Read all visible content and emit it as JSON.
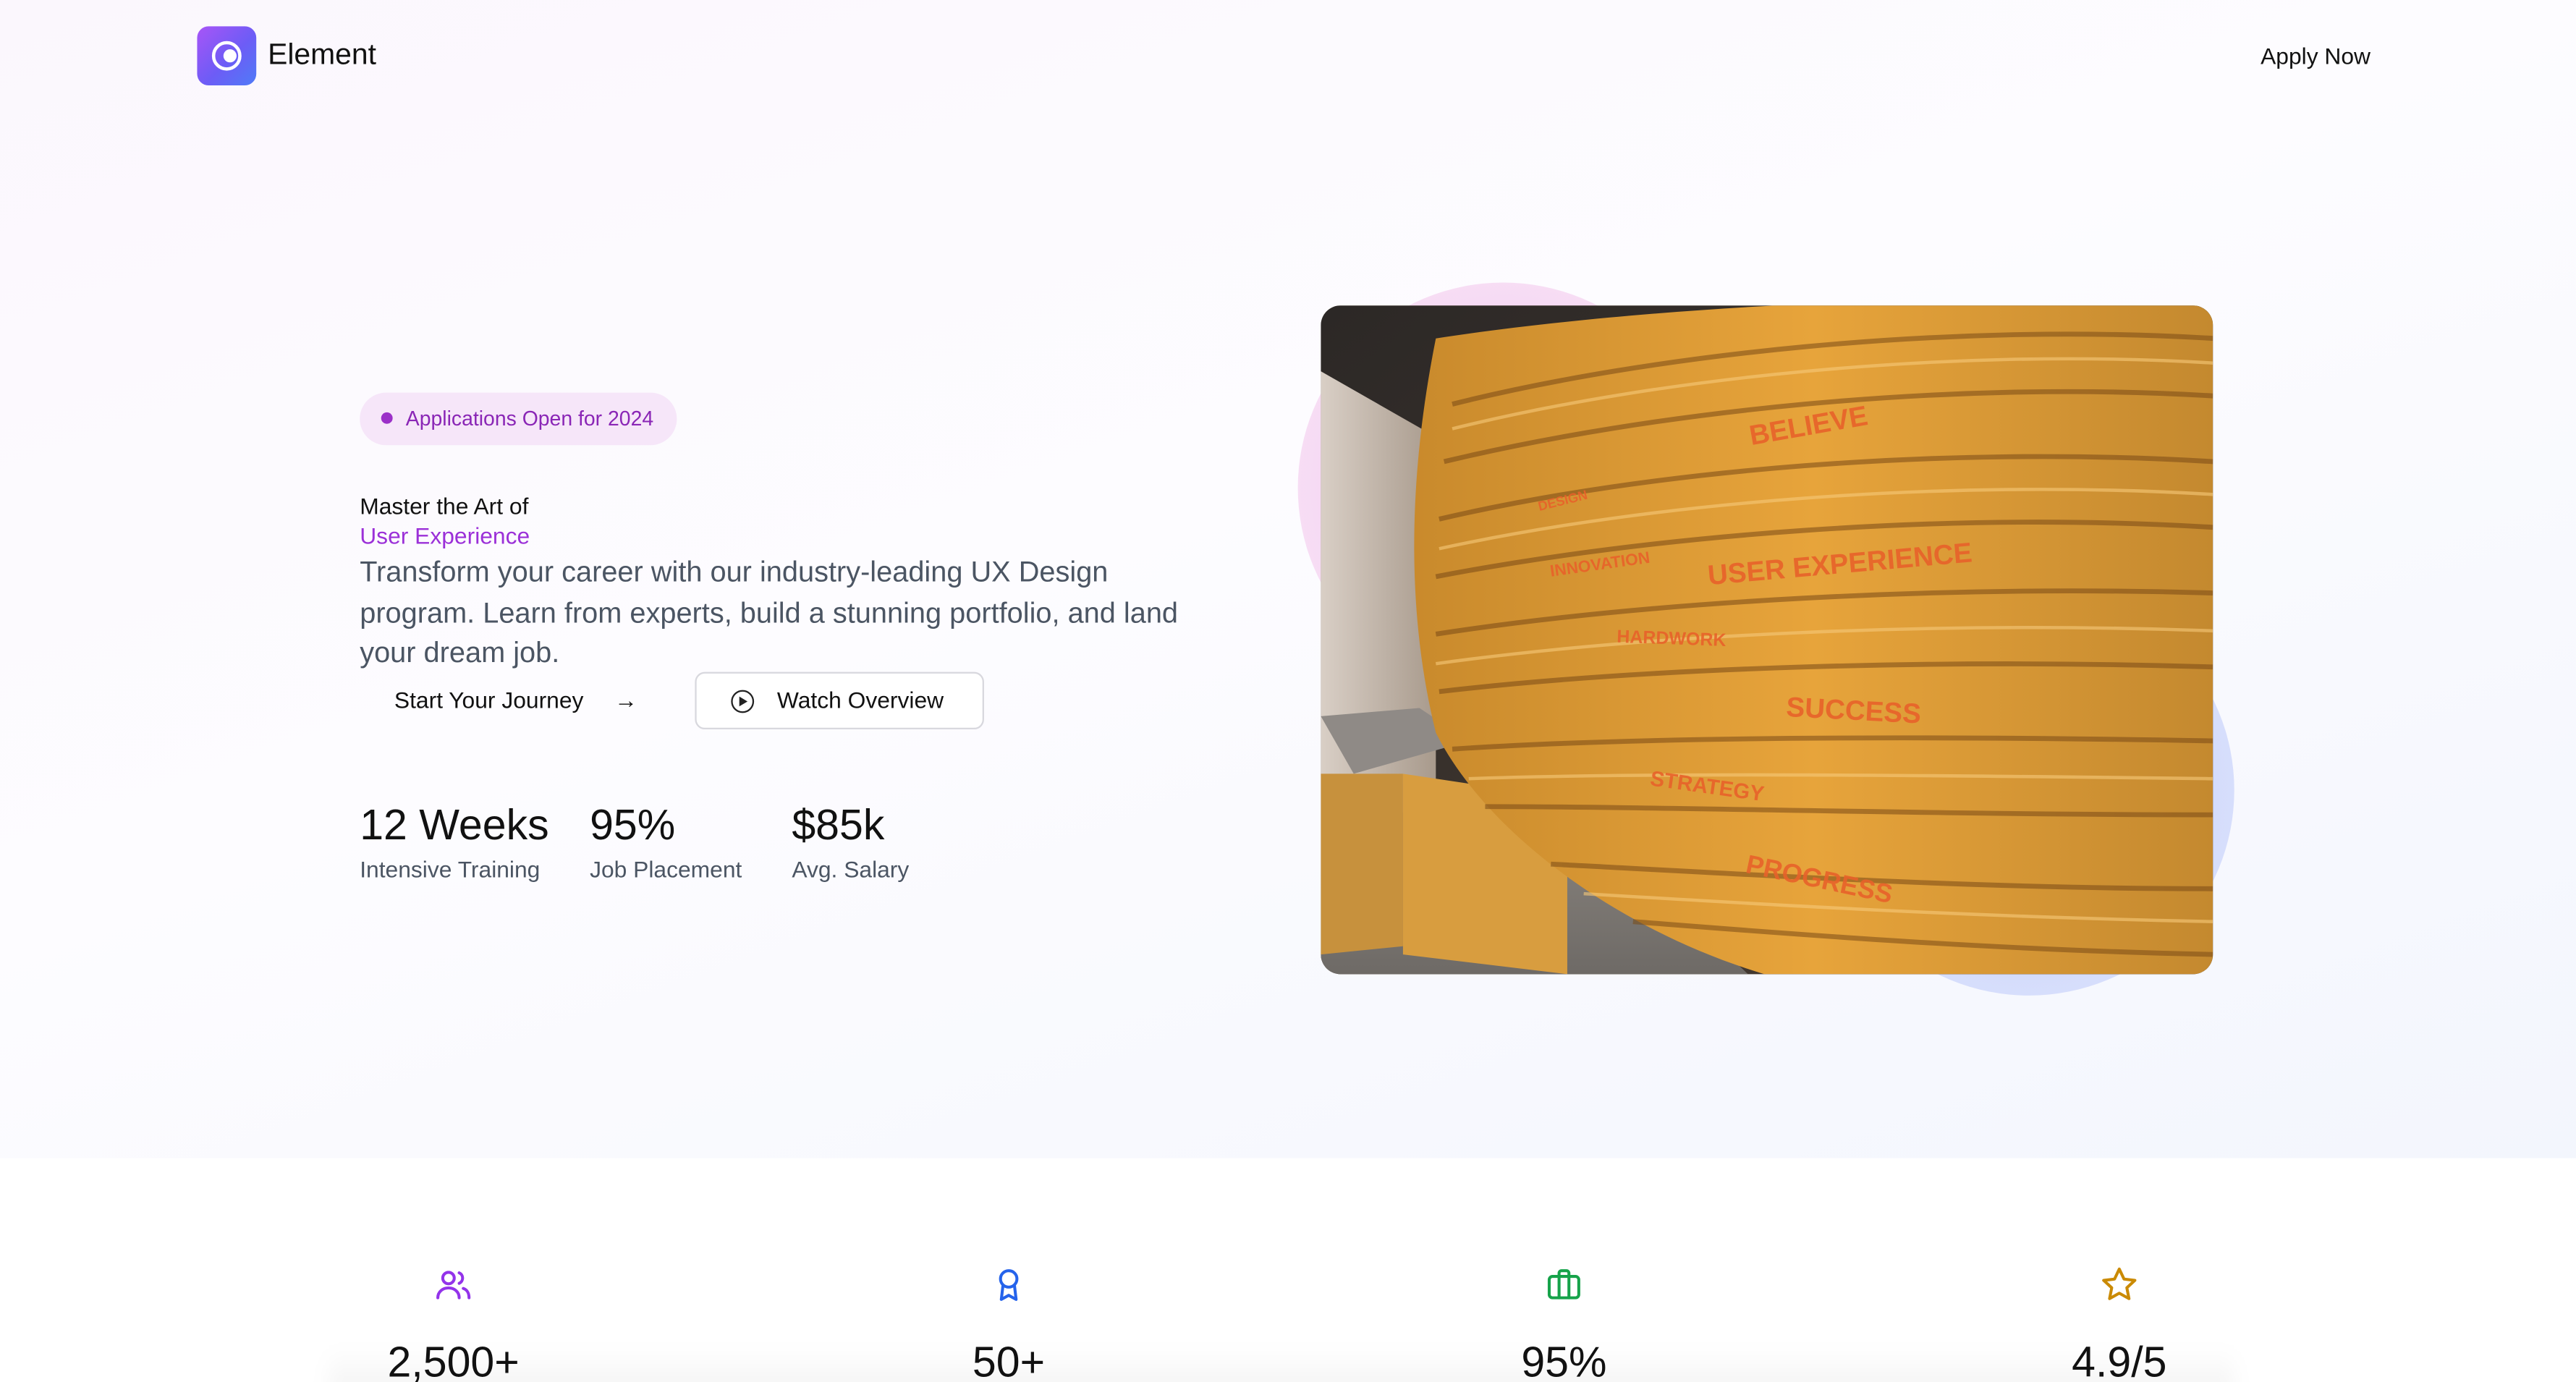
{
  "header": {
    "brand": "Element",
    "apply_label": "Apply Now"
  },
  "hero": {
    "badge": "Applications Open for 2024",
    "title_line1": "Master the Art of",
    "title_line2": "User Experience",
    "lead": "Transform your career with our industry-leading UX Design program. Learn from experts, build a stunning portfolio, and land your dream job.",
    "primary_cta": "Start Your Journey",
    "secondary_cta": "Watch Overview",
    "stats": [
      {
        "value": "12 Weeks",
        "label": "Intensive Training"
      },
      {
        "value": "95%",
        "label": "Job Placement"
      },
      {
        "value": "$85k",
        "label": "Avg. Salary"
      }
    ],
    "photo_words": [
      "BELIEVE",
      "DESIGN",
      "INNOVATION",
      "USER EXPERIENCE",
      "HARDWORK",
      "SUCCESS",
      "STRATEGY",
      "PROGRESS"
    ]
  },
  "features": [
    {
      "icon": "users-icon",
      "value": "2,500+",
      "color": "#9333ea"
    },
    {
      "icon": "award-icon",
      "value": "50+",
      "color": "#2563eb"
    },
    {
      "icon": "briefcase-icon",
      "value": "95%",
      "color": "#16a34a"
    },
    {
      "icon": "star-icon",
      "value": "4.9/5",
      "color": "#ca8a04"
    }
  ],
  "colors": {
    "accent": "#9b30d8",
    "badge_bg": "#f6e6f9",
    "text_muted": "#4b5563"
  }
}
